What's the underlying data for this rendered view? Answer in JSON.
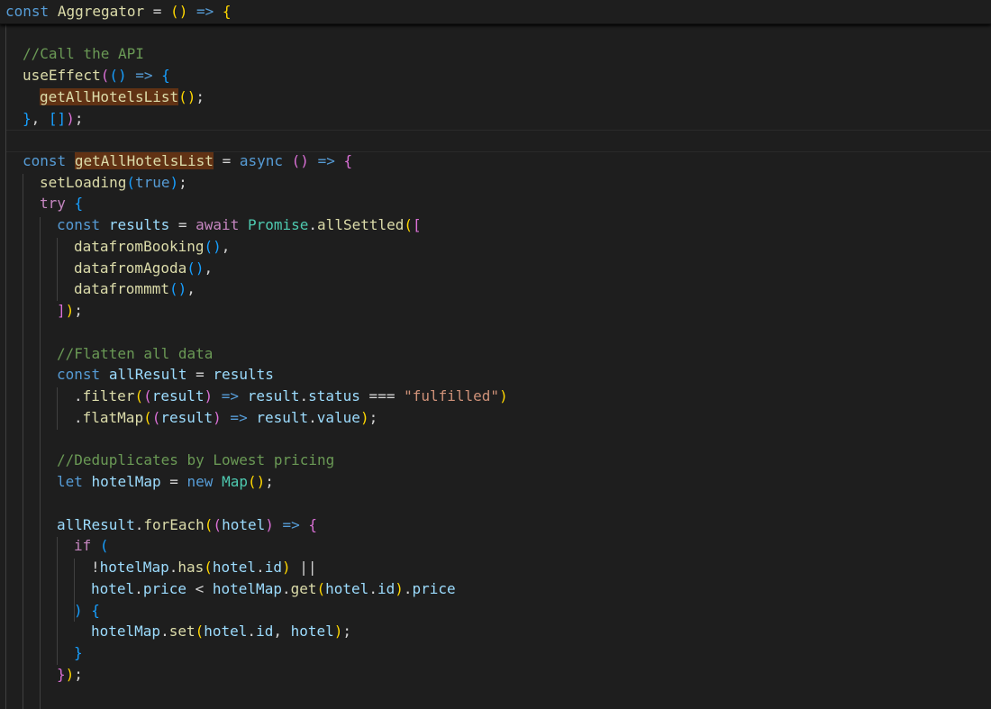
{
  "editor": {
    "theme": {
      "background": "#1e1e1e",
      "keyword": "#569cd6",
      "control": "#c586c0",
      "function": "#dcdcaa",
      "variable": "#9cdcfe",
      "type": "#4ec9b0",
      "string": "#ce9178",
      "comment": "#6a9955",
      "highlight": "#613214"
    },
    "sticky_line": "const Aggregator = () => {",
    "lines": [
      "//Call the API",
      "useEffect(() => {",
      "getAllHotelsList();",
      "}, []);",
      "",
      "const getAllHotelsList = async () => {",
      "setLoading(true);",
      "try {",
      "const results = await Promise.allSettled([",
      "datafromBooking(),",
      "datafromAgoda(),",
      "datafrommmt(),",
      "]);",
      "",
      "//Flatten all data",
      "const allResult = results",
      ".filter((result) => result.status === \"fulfilled\")",
      ".flatMap((result) => result.value);",
      "",
      "//Deduplicates by Lowest pricing",
      "let hotelMap = new Map();",
      "",
      "allResult.forEach((hotel) => {",
      "if (",
      "!hotelMap.has(hotel.id) ||",
      "hotel.price < hotelMap.get(hotel.id).price",
      ") {",
      "hotelMap.set(hotel.id, hotel);",
      "}",
      "});"
    ],
    "tokens": {
      "t_const": "const",
      "t_aggregator": "Aggregator",
      "t_eq": " = ",
      "t_lparen": "(",
      "t_rparen": ")",
      "t_arrow": " => ",
      "t_lbrace": "{",
      "t_comment_api": "//Call the API",
      "t_useeffect": "useEffect",
      "t_getall": "getAllHotelsList",
      "t_semi": ";",
      "t_rbrace": "}",
      "t_comma": ", ",
      "t_lbrack": "[",
      "t_rbrack": "]",
      "t_async": "async",
      "t_setloading": "setLoading",
      "t_true": "true",
      "t_try": "try",
      "t_results": "results",
      "t_await": "await",
      "t_promise": "Promise",
      "t_dot": ".",
      "t_allsettled": "allSettled",
      "t_booking": "datafromBooking",
      "t_agoda": "datafromAgoda",
      "t_mmt": "datafrommmt",
      "t_commaonly": ",",
      "t_comment_flat": "//Flatten all data",
      "t_allresult": "allResult",
      "t_filter": "filter",
      "t_result": "result",
      "t_status": "status",
      "t_eqq": " === ",
      "t_fulfilled": "\"fulfilled\"",
      "t_flatmap": "flatMap",
      "t_value": "value",
      "t_comment_dedup": "//Deduplicates by Lowest pricing",
      "t_let": "let",
      "t_hotelmap": "hotelMap",
      "t_new": "new",
      "t_map": "Map",
      "t_foreach": "forEach",
      "t_hotel": "hotel",
      "t_if": "if",
      "t_not": "!",
      "t_has": "has",
      "t_id": "id",
      "t_or": " ||",
      "t_price": "price",
      "t_lt": " < ",
      "t_get": "get",
      "t_set": "set",
      "t_space": " "
    }
  }
}
